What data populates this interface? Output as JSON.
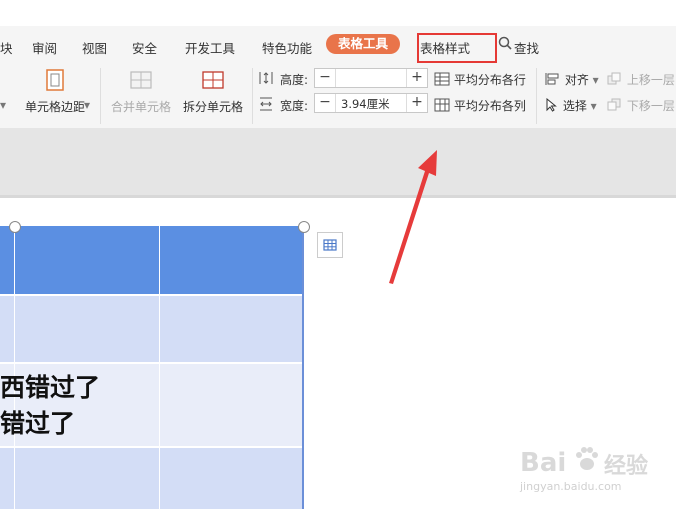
{
  "tabs": [
    {
      "label": "块"
    },
    {
      "label": "审阅"
    },
    {
      "label": "视图"
    },
    {
      "label": "安全"
    },
    {
      "label": "开发工具"
    },
    {
      "label": "特色功能"
    },
    {
      "label": "表格工具"
    },
    {
      "label": "表格样式"
    },
    {
      "label": "查找"
    }
  ],
  "ribbon": {
    "cell_margin": "单元格边距",
    "merge_cells": "合并单元格",
    "split_cells": "拆分单元格",
    "height_label": "高度:",
    "width_label": "宽度:",
    "height_value": "",
    "width_value": "3.94厘米",
    "distribute_rows": "平均分布各行",
    "distribute_cols": "平均分布各列",
    "align": "对齐",
    "select": "选择",
    "move_up": "上移一层",
    "move_down": "下移一层"
  },
  "document": {
    "line1": "西错过了",
    "line2": "错过了"
  },
  "watermark": {
    "brand": "Bai",
    "brand_suffix": "经验",
    "url": "jingyan.baidu.com"
  },
  "colors": {
    "active_tab": "#e9744a",
    "header_row": "#5b8fe2",
    "table_body": "#d3ddf6",
    "highlight_box": "#e53935"
  }
}
